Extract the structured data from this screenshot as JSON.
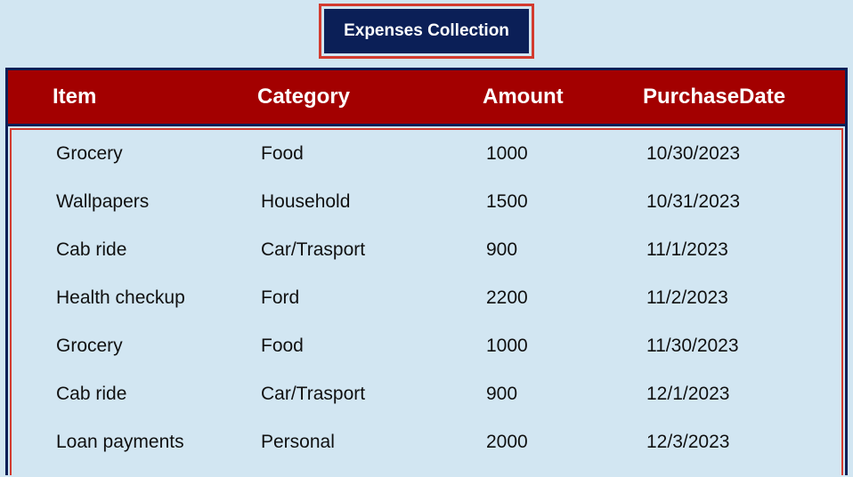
{
  "title": "Expenses Collection",
  "table": {
    "headers": {
      "item": "Item",
      "category": "Category",
      "amount": "Amount",
      "purchaseDate": "PurchaseDate"
    },
    "rows": [
      {
        "item": "Grocery",
        "category": "Food",
        "amount": "1000",
        "purchaseDate": "10/30/2023"
      },
      {
        "item": "Wallpapers",
        "category": "Household",
        "amount": "1500",
        "purchaseDate": "10/31/2023"
      },
      {
        "item": "Cab ride",
        "category": "Car/Trasport",
        "amount": "900",
        "purchaseDate": "11/1/2023"
      },
      {
        "item": "Health checkup",
        "category": "Ford",
        "amount": "2200",
        "purchaseDate": "11/2/2023"
      },
      {
        "item": "Grocery",
        "category": "Food",
        "amount": "1000",
        "purchaseDate": "11/30/2023"
      },
      {
        "item": "Cab ride",
        "category": "Car/Trasport",
        "amount": "900",
        "purchaseDate": "12/1/2023"
      },
      {
        "item": "Loan payments",
        "category": "Personal",
        "amount": "2000",
        "purchaseDate": "12/3/2023"
      }
    ]
  }
}
